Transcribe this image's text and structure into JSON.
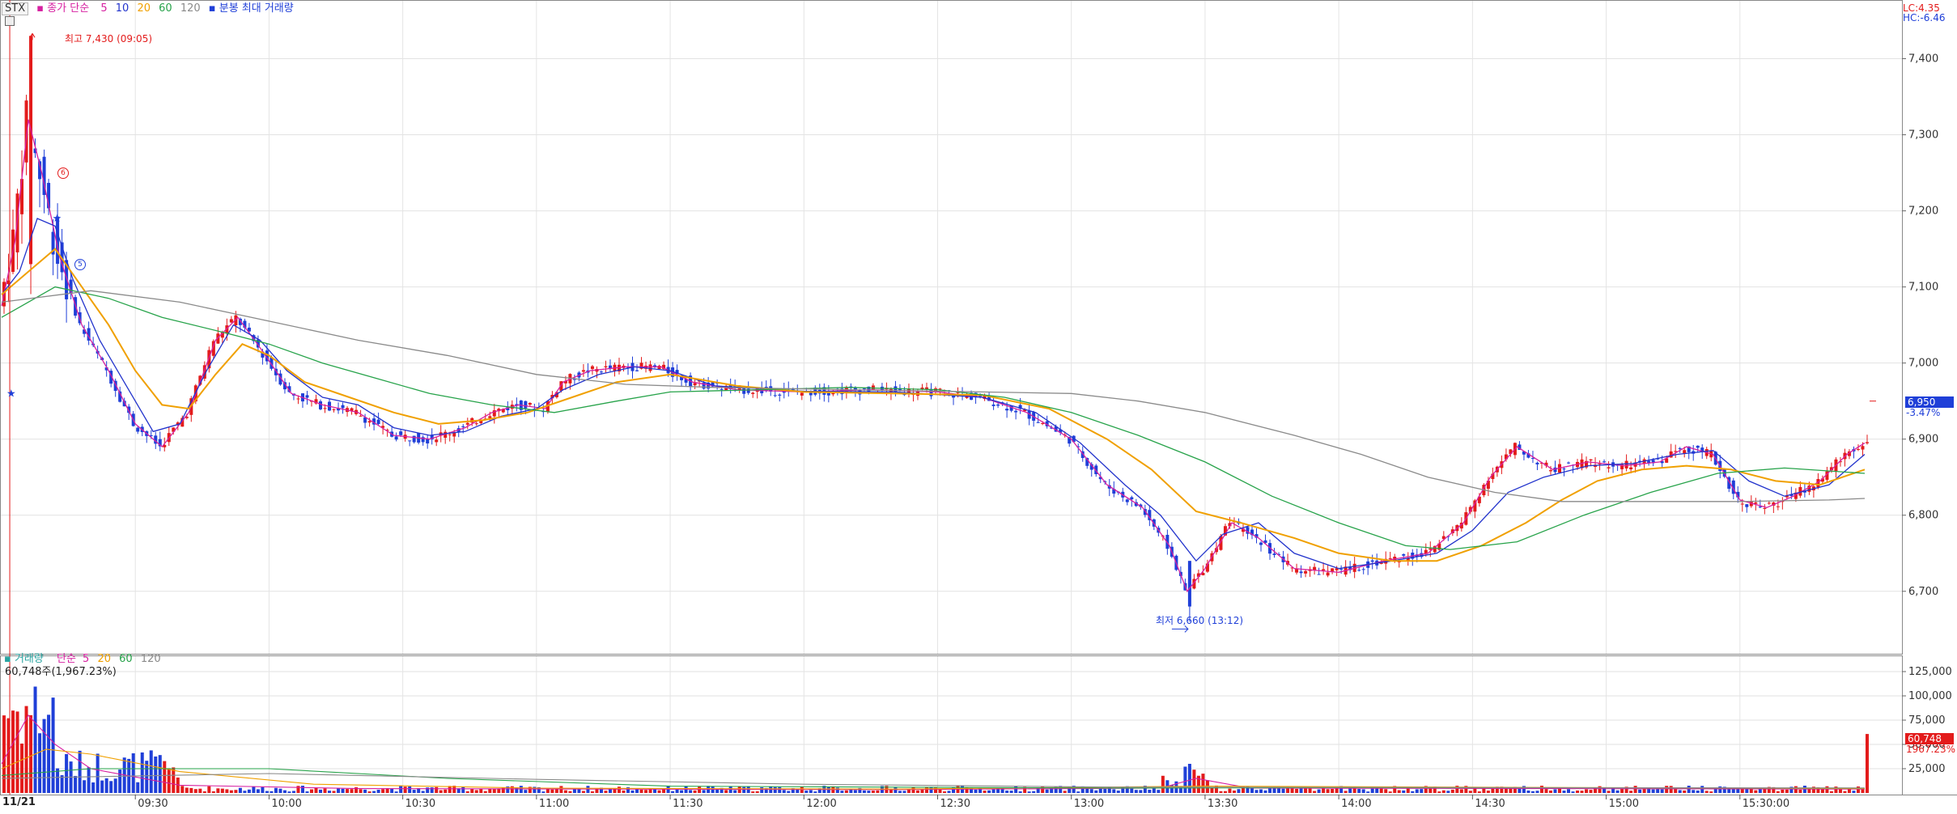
{
  "legend": {
    "symbol": "STX",
    "price_legend": {
      "label": "종가 단순",
      "ma": [
        "5",
        "10",
        "20",
        "60",
        "120"
      ],
      "extra": "분봉 최대 거래량"
    },
    "volume_legend": {
      "label1": "거래량",
      "label2": "단순",
      "ma": [
        "5",
        "20",
        "60",
        "120"
      ]
    },
    "volume_readout": "60,748주(1,967.23%)"
  },
  "corner": {
    "lc": "LC:4.35",
    "hc": "HC:-6.46"
  },
  "markers": {
    "high": "최고 7,430 (09:05)",
    "low": "최저 6,660 (13:12)",
    "badge_6": "6",
    "badge_5": "5"
  },
  "price_tag": {
    "price": "6,950",
    "change": "-3.47%"
  },
  "volume_tag": {
    "value": "60,748",
    "pct": "1967.23%"
  },
  "date_label": "11/21",
  "colors": {
    "up": "#e31b1b",
    "down": "#1f3fd8",
    "ma5": "#d61fa0",
    "ma10": "#2233cc",
    "ma20": "#f0a000",
    "ma60": "#27a34a",
    "ma120": "#8a8a8a"
  },
  "chart_data": [
    {
      "type": "candlestick",
      "title": "",
      "x_ticks": [
        "09:30",
        "10:00",
        "10:30",
        "11:00",
        "11:30",
        "12:00",
        "12:30",
        "13:00",
        "13:30",
        "14:00",
        "14:30",
        "15:00",
        "15:30:00"
      ],
      "x_range": [
        "09:00",
        "15:30"
      ],
      "y_ticks": [
        "7,400",
        "7,300",
        "7,200",
        "7,100",
        "7,000",
        "6,900",
        "6,800",
        "6,700"
      ],
      "ylim": [
        6620,
        7475
      ],
      "grid": true,
      "series": [
        {
          "name": "5",
          "values": [
            [
              0,
              7075
            ],
            [
              3,
              7160
            ],
            [
              6,
              7320
            ],
            [
              9,
              7250
            ],
            [
              13,
              7140
            ],
            [
              18,
              7050
            ],
            [
              24,
              6990
            ],
            [
              30,
              6920
            ],
            [
              36,
              6890
            ],
            [
              42,
              6935
            ],
            [
              48,
              7030
            ],
            [
              53,
              7060
            ],
            [
              58,
              7020
            ],
            [
              65,
              6960
            ],
            [
              72,
              6945
            ],
            [
              80,
              6935
            ],
            [
              88,
              6905
            ],
            [
              96,
              6900
            ],
            [
              104,
              6915
            ],
            [
              110,
              6935
            ],
            [
              116,
              6945
            ],
            [
              122,
              6940
            ],
            [
              126,
              6975
            ],
            [
              132,
              6990
            ],
            [
              140,
              6995
            ],
            [
              148,
              6995
            ],
            [
              155,
              6975
            ],
            [
              165,
              6965
            ],
            [
              180,
              6962
            ],
            [
              195,
              6965
            ],
            [
              210,
              6962
            ],
            [
              220,
              6955
            ],
            [
              230,
              6935
            ],
            [
              240,
              6900
            ],
            [
              248,
              6840
            ],
            [
              256,
              6810
            ],
            [
              262,
              6760
            ],
            [
              266,
              6700
            ],
            [
              270,
              6730
            ],
            [
              276,
              6790
            ],
            [
              282,
              6770
            ],
            [
              290,
              6730
            ],
            [
              300,
              6725
            ],
            [
              310,
              6740
            ],
            [
              320,
              6750
            ],
            [
              328,
              6790
            ],
            [
              334,
              6850
            ],
            [
              340,
              6890
            ],
            [
              348,
              6860
            ],
            [
              356,
              6870
            ],
            [
              364,
              6865
            ],
            [
              372,
              6870
            ],
            [
              378,
              6890
            ],
            [
              384,
              6880
            ],
            [
              390,
              6820
            ],
            [
              396,
              6810
            ],
            [
              402,
              6825
            ],
            [
              408,
              6845
            ],
            [
              414,
              6880
            ],
            [
              418,
              6895
            ]
          ]
        },
        {
          "name": "10",
          "values": [
            [
              0,
              7090
            ],
            [
              4,
              7120
            ],
            [
              8,
              7190
            ],
            [
              12,
              7180
            ],
            [
              16,
              7110
            ],
            [
              22,
              7030
            ],
            [
              28,
              6970
            ],
            [
              34,
              6910
            ],
            [
              40,
              6920
            ],
            [
              46,
              6990
            ],
            [
              52,
              7050
            ],
            [
              58,
              7030
            ],
            [
              64,
              6990
            ],
            [
              72,
              6955
            ],
            [
              80,
              6945
            ],
            [
              88,
              6915
            ],
            [
              96,
              6905
            ],
            [
              104,
              6910
            ],
            [
              112,
              6930
            ],
            [
              120,
              6940
            ],
            [
              126,
              6965
            ],
            [
              134,
              6985
            ],
            [
              142,
              6995
            ],
            [
              150,
              6990
            ],
            [
              160,
              6970
            ],
            [
              180,
              6963
            ],
            [
              200,
              6962
            ],
            [
              220,
              6955
            ],
            [
              232,
              6935
            ],
            [
              242,
              6895
            ],
            [
              252,
              6840
            ],
            [
              260,
              6800
            ],
            [
              268,
              6740
            ],
            [
              274,
              6775
            ],
            [
              282,
              6790
            ],
            [
              290,
              6750
            ],
            [
              300,
              6730
            ],
            [
              312,
              6740
            ],
            [
              322,
              6750
            ],
            [
              330,
              6780
            ],
            [
              338,
              6830
            ],
            [
              346,
              6850
            ],
            [
              356,
              6865
            ],
            [
              366,
              6868
            ],
            [
              376,
              6880
            ],
            [
              384,
              6885
            ],
            [
              392,
              6845
            ],
            [
              400,
              6825
            ],
            [
              410,
              6840
            ],
            [
              418,
              6880
            ]
          ]
        },
        {
          "name": "20",
          "values": [
            [
              0,
              7090
            ],
            [
              6,
              7120
            ],
            [
              12,
              7150
            ],
            [
              18,
              7100
            ],
            [
              24,
              7050
            ],
            [
              30,
              6990
            ],
            [
              36,
              6945
            ],
            [
              42,
              6940
            ],
            [
              48,
              6985
            ],
            [
              54,
              7025
            ],
            [
              60,
              7010
            ],
            [
              68,
              6975
            ],
            [
              78,
              6955
            ],
            [
              88,
              6935
            ],
            [
              98,
              6920
            ],
            [
              108,
              6925
            ],
            [
              118,
              6935
            ],
            [
              128,
              6955
            ],
            [
              138,
              6975
            ],
            [
              150,
              6985
            ],
            [
              165,
              6970
            ],
            [
              180,
              6962
            ],
            [
              200,
              6960
            ],
            [
              220,
              6958
            ],
            [
              235,
              6940
            ],
            [
              248,
              6900
            ],
            [
              258,
              6860
            ],
            [
              268,
              6805
            ],
            [
              278,
              6790
            ],
            [
              290,
              6770
            ],
            [
              300,
              6750
            ],
            [
              312,
              6740
            ],
            [
              322,
              6740
            ],
            [
              332,
              6760
            ],
            [
              342,
              6790
            ],
            [
              350,
              6820
            ],
            [
              358,
              6845
            ],
            [
              368,
              6860
            ],
            [
              378,
              6865
            ],
            [
              388,
              6860
            ],
            [
              398,
              6845
            ],
            [
              408,
              6840
            ],
            [
              418,
              6860
            ]
          ]
        },
        {
          "name": "60",
          "values": [
            [
              0,
              7060
            ],
            [
              12,
              7100
            ],
            [
              24,
              7085
            ],
            [
              36,
              7060
            ],
            [
              50,
              7040
            ],
            [
              60,
              7025
            ],
            [
              72,
              7000
            ],
            [
              84,
              6980
            ],
            [
              96,
              6960
            ],
            [
              110,
              6945
            ],
            [
              124,
              6935
            ],
            [
              138,
              6950
            ],
            [
              150,
              6962
            ],
            [
              170,
              6965
            ],
            [
              190,
              6968
            ],
            [
              210,
              6965
            ],
            [
              225,
              6955
            ],
            [
              240,
              6935
            ],
            [
              255,
              6905
            ],
            [
              270,
              6870
            ],
            [
              285,
              6825
            ],
            [
              300,
              6790
            ],
            [
              315,
              6760
            ],
            [
              325,
              6755
            ],
            [
              340,
              6765
            ],
            [
              355,
              6800
            ],
            [
              370,
              6830
            ],
            [
              385,
              6855
            ],
            [
              400,
              6862
            ],
            [
              418,
              6855
            ]
          ]
        },
        {
          "name": "120",
          "values": [
            [
              0,
              7080
            ],
            [
              20,
              7095
            ],
            [
              40,
              7080
            ],
            [
              60,
              7055
            ],
            [
              80,
              7030
            ],
            [
              100,
              7010
            ],
            [
              120,
              6985
            ],
            [
              140,
              6972
            ],
            [
              160,
              6968
            ],
            [
              190,
              6965
            ],
            [
              220,
              6962
            ],
            [
              240,
              6960
            ],
            [
              255,
              6950
            ],
            [
              270,
              6935
            ],
            [
              290,
              6905
            ],
            [
              305,
              6880
            ],
            [
              320,
              6850
            ],
            [
              335,
              6830
            ],
            [
              350,
              6818
            ],
            [
              370,
              6818
            ],
            [
              390,
              6818
            ],
            [
              410,
              6820
            ],
            [
              418,
              6822
            ]
          ]
        }
      ]
    },
    {
      "type": "bar",
      "title": "",
      "y_ticks": [
        "125,000",
        "100,000",
        "75,000",
        "50,000",
        "25,000"
      ],
      "ylim": [
        0,
        140000
      ],
      "last_bar": 60748,
      "grid": true
    }
  ]
}
